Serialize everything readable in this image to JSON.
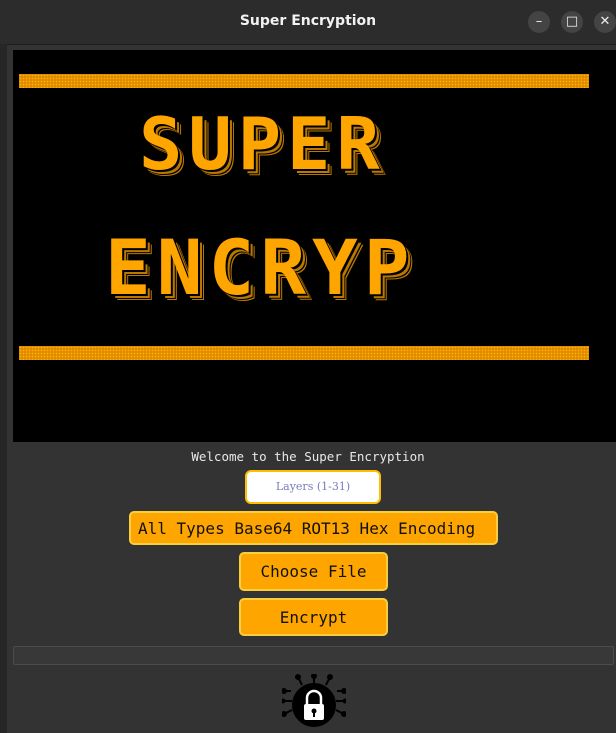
{
  "window": {
    "title": "Super Encryption",
    "minimize_glyph": "–",
    "maximize_glyph": "□",
    "close_glyph": "✕"
  },
  "banner": {
    "line1": "SUPER",
    "line2": "ENCRYP",
    "accent_color": "#ffa500"
  },
  "welcome_text": "Welcome to the Super Encryption",
  "layers_input": {
    "placeholder": "Layers (1-31)",
    "value": ""
  },
  "types_select": {
    "selected": "All Types Base64 ROT13 Hex Encoding"
  },
  "buttons": {
    "choose_file": "Choose File",
    "encrypt": "Encrypt"
  },
  "progress": {
    "value": 0
  },
  "logo": {
    "icon": "padlock-circuit-icon"
  }
}
